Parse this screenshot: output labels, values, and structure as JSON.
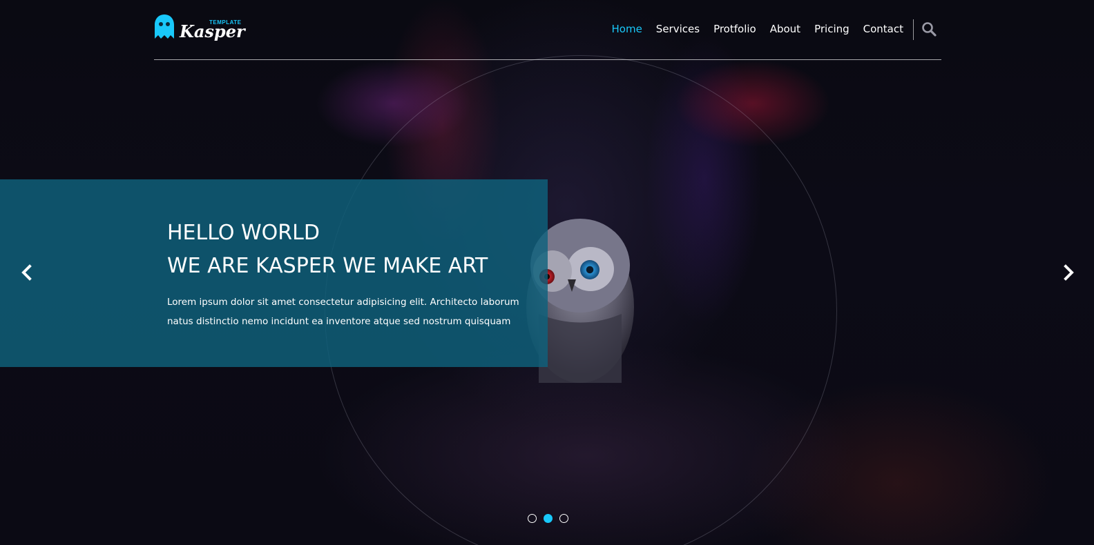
{
  "brand": {
    "logo_small": "TEMPLATE",
    "logo_word": "Kasper",
    "logo_icon": "ghost-icon",
    "accent_color": "#19c8fa"
  },
  "nav": {
    "items": [
      {
        "label": "Home",
        "active": true
      },
      {
        "label": "Services",
        "active": false
      },
      {
        "label": "Protfolio",
        "active": false
      },
      {
        "label": "About",
        "active": false
      },
      {
        "label": "Pricing",
        "active": false
      },
      {
        "label": "Contact",
        "active": false
      }
    ],
    "search_icon": "search-icon"
  },
  "hero": {
    "title_line1": "HELLO WORLD",
    "title_line2": "WE ARE KASPER WE MAKE ART",
    "description": "Lorem ipsum dolor sit amet consectetur adipisicing elit. Architecto laborum natus distinctio nemo incidunt ea inventore atque sed nostrum quisquam",
    "box_color": "#0f617d",
    "prev_icon": "chevron-left-icon",
    "next_icon": "chevron-right-icon"
  },
  "slider": {
    "bullet_count": 3,
    "active_index": 1
  }
}
